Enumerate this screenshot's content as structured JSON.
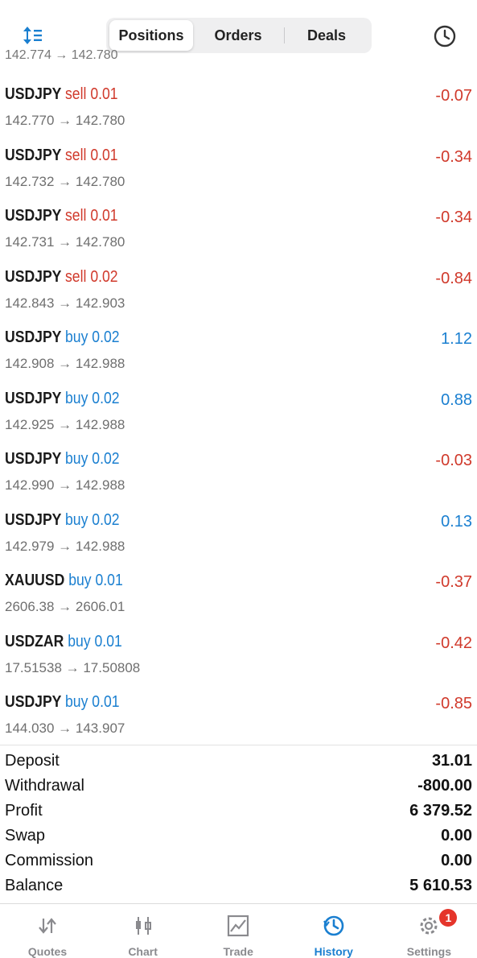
{
  "header": {
    "tabs": [
      {
        "label": "Positions",
        "active": true
      },
      {
        "label": "Orders",
        "active": false
      },
      {
        "label": "Deals",
        "active": false
      }
    ],
    "sort_icon": "sort-icon",
    "history_icon": "clock-icon"
  },
  "partial_row": {
    "prices": "142.774 → 142.780"
  },
  "deals": [
    {
      "symbol": "USDJPY",
      "side": "sell",
      "volume": "0.01",
      "prices": "142.770 → 142.780",
      "profit": "-0.07"
    },
    {
      "symbol": "USDJPY",
      "side": "sell",
      "volume": "0.01",
      "prices": "142.732 → 142.780",
      "profit": "-0.34"
    },
    {
      "symbol": "USDJPY",
      "side": "sell",
      "volume": "0.01",
      "prices": "142.731 → 142.780",
      "profit": "-0.34"
    },
    {
      "symbol": "USDJPY",
      "side": "sell",
      "volume": "0.02",
      "prices": "142.843 → 142.903",
      "profit": "-0.84"
    },
    {
      "symbol": "USDJPY",
      "side": "buy",
      "volume": "0.02",
      "prices": "142.908 → 142.988",
      "profit": "1.12"
    },
    {
      "symbol": "USDJPY",
      "side": "buy",
      "volume": "0.02",
      "prices": "142.925 → 142.988",
      "profit": "0.88"
    },
    {
      "symbol": "USDJPY",
      "side": "buy",
      "volume": "0.02",
      "prices": "142.990 → 142.988",
      "profit": "-0.03"
    },
    {
      "symbol": "USDJPY",
      "side": "buy",
      "volume": "0.02",
      "prices": "142.979 → 142.988",
      "profit": "0.13"
    },
    {
      "symbol": "XAUUSD",
      "side": "buy",
      "volume": "0.01",
      "prices": "2606.38 → 2606.01",
      "profit": "-0.37"
    },
    {
      "symbol": "USDZAR",
      "side": "buy",
      "volume": "0.01",
      "prices": "17.51538 → 17.50808",
      "profit": "-0.42"
    },
    {
      "symbol": "USDJPY",
      "side": "buy",
      "volume": "0.01",
      "prices": "144.030 → 143.907",
      "profit": "-0.85"
    }
  ],
  "summary": [
    {
      "label": "Deposit",
      "value": "31.01"
    },
    {
      "label": "Withdrawal",
      "value": "-800.00"
    },
    {
      "label": "Profit",
      "value": "6 379.52"
    },
    {
      "label": "Swap",
      "value": "0.00"
    },
    {
      "label": "Commission",
      "value": "0.00"
    },
    {
      "label": "Balance",
      "value": "5 610.53"
    }
  ],
  "tabbar": [
    {
      "label": "Quotes",
      "icon": "quotes-arrows-icon",
      "active": false
    },
    {
      "label": "Chart",
      "icon": "candlestick-chart-icon",
      "active": false
    },
    {
      "label": "Trade",
      "icon": "trade-chart-icon",
      "active": false
    },
    {
      "label": "History",
      "icon": "history-clock-icon",
      "active": true
    },
    {
      "label": "Settings",
      "icon": "gear-icon",
      "active": false,
      "badge": "1"
    }
  ],
  "colors": {
    "sell": "#d0392b",
    "buy": "#1a7fd0",
    "negative": "#d0392b",
    "positive": "#1a7fd0",
    "active_tab": "#1a7fd0",
    "badge": "#e5352b"
  }
}
